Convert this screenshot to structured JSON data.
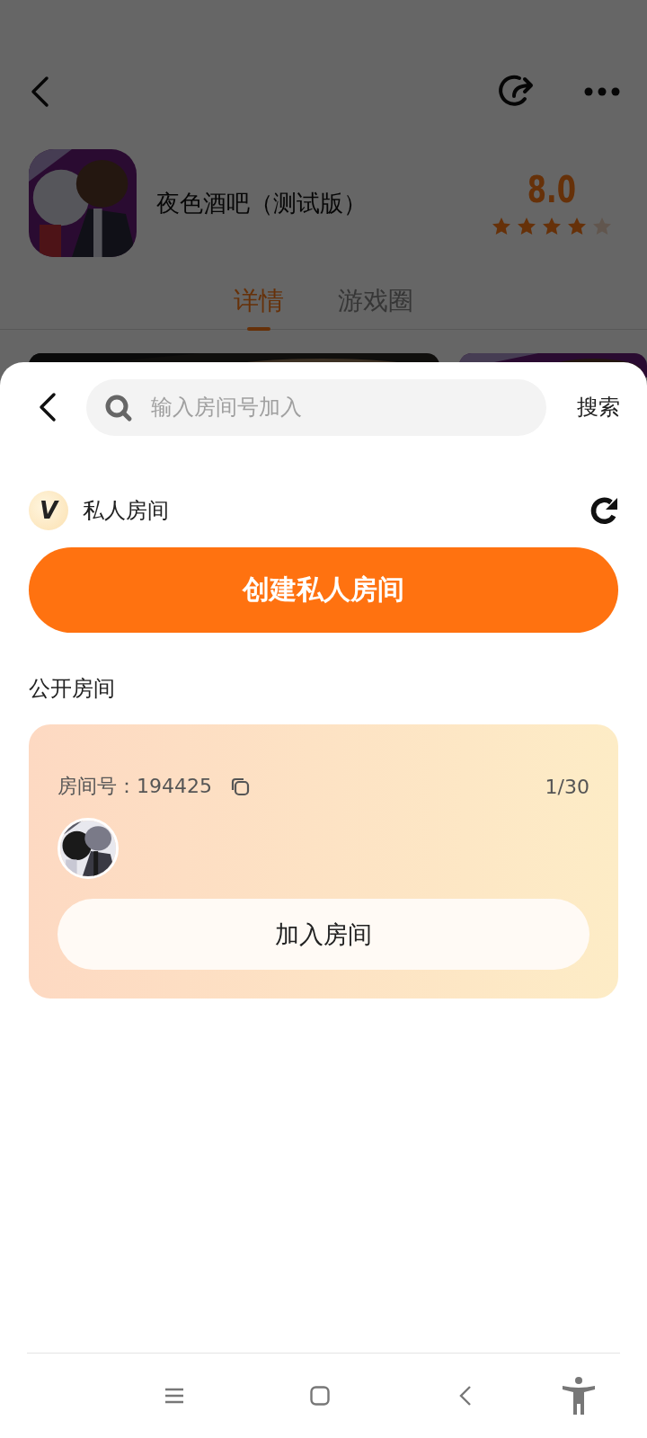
{
  "header": {
    "app": {
      "title": "夜色酒吧（测试版）",
      "rating": "8.0",
      "stars": 4
    },
    "tabs": [
      {
        "label": "详情",
        "selected": true
      },
      {
        "label": "游戏圈",
        "selected": false
      }
    ]
  },
  "sheet": {
    "search": {
      "placeholder": "输入房间号加入"
    },
    "search_button": "搜索",
    "private_section": {
      "badge": "V",
      "title": "私人房间"
    },
    "create_button": "创建私人房间",
    "public_section": {
      "title": "公开房间"
    },
    "rooms": [
      {
        "room_number": "房间号：194425",
        "occupancy": "1/30",
        "join_button": "加入房间"
      }
    ]
  }
}
